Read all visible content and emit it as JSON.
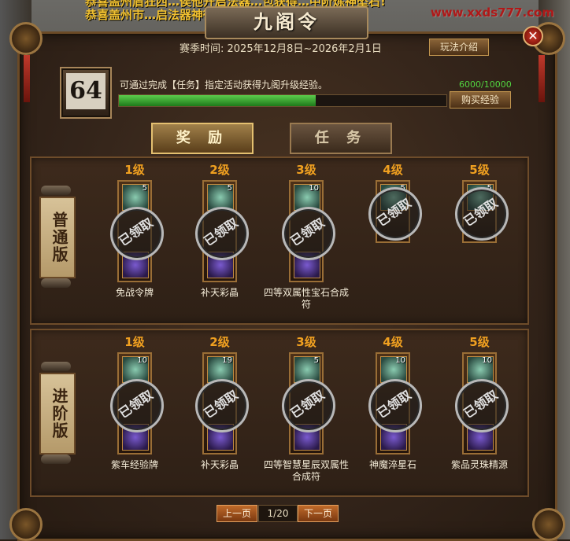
{
  "ticker": {
    "line1": "恭喜盖州盾狂西…侯他开启法器…包获得…中阶炼神坠石!",
    "line2": "恭喜盖州市…启法器神御宝…获得…神瞳鉴神石!"
  },
  "watermark": "www.xxds777.com",
  "window": {
    "title": "九阁令",
    "close_label": "✕",
    "season_text": "赛季时间: 2025年12月8日~2026年2月1日",
    "rules_button": "玩法介绍"
  },
  "progress": {
    "level": "64",
    "description": "可通过完成【任务】指定活动获得九阁升级经验。",
    "exp_text": "6000/10000",
    "exp_fraction": 0.6,
    "buy_button": "购买经验"
  },
  "tabs": {
    "reward": "奖 励",
    "task": "任 务"
  },
  "rows": [
    {
      "label": "普通版",
      "items": [
        {
          "level": "1级",
          "qty": "5",
          "name": "免战令牌",
          "stamp": "已领取"
        },
        {
          "level": "2级",
          "qty": "5",
          "name": "补天彩晶",
          "stamp": "已领取"
        },
        {
          "level": "3级",
          "qty": "10",
          "name": "四等双属性宝石合成符",
          "stamp": "已领取"
        },
        {
          "level": "4级",
          "qty": "5",
          "name": "",
          "stamp": "已领取"
        },
        {
          "level": "5级",
          "qty": "5",
          "name": "",
          "stamp": "已领取"
        }
      ]
    },
    {
      "label": "进阶版",
      "items": [
        {
          "level": "1级",
          "qty": "10",
          "name": "紫车经验牌",
          "stamp": "已领取"
        },
        {
          "level": "2级",
          "qty": "19",
          "name": "补天彩晶",
          "stamp": "已领取"
        },
        {
          "level": "3级",
          "qty": "5",
          "name": "四等智慧星辰双属性合成符",
          "stamp": "已领取"
        },
        {
          "level": "4级",
          "qty": "10",
          "name": "神魔淬星石",
          "stamp": "已领取"
        },
        {
          "level": "5级",
          "qty": "10",
          "name": "紫品灵珠精源",
          "stamp": "已领取"
        }
      ]
    }
  ],
  "pager": {
    "prev": "上一页",
    "indicator": "1/20",
    "next": "下一页"
  },
  "colors": {
    "accent_gold": "#f0a020",
    "exp_green": "#52d640",
    "close_red": "#d23a2a"
  }
}
